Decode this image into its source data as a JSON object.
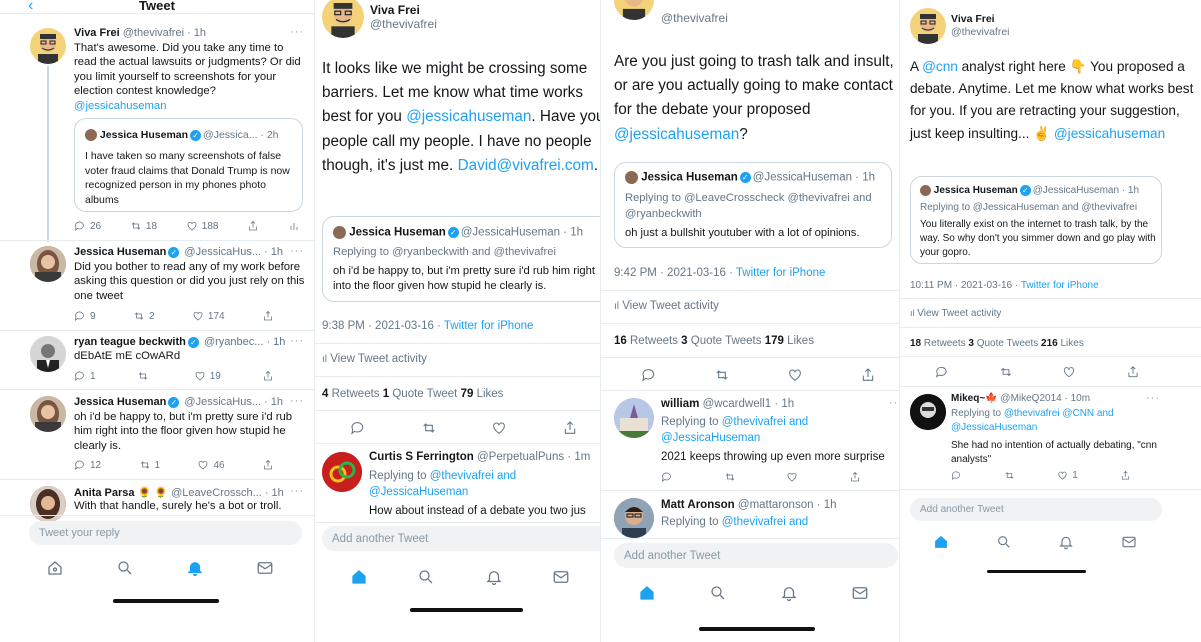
{
  "panel1": {
    "header_title": "Tweet",
    "tweet1": {
      "name": "Viva Frei",
      "handle": "@thevivafrei · 1h",
      "text": "That's awesome. Did you take any time to read the actual lawsuits or judgments? Or did you limit yourself to screenshots for your election contest knowledge?",
      "mention": "@jessicahuseman",
      "quote": {
        "name": "Jessica Huseman",
        "handle": "@Jessica...",
        "time": "· 2h",
        "text": "I have taken so many screenshots of false voter fraud claims that Donald Trump is now recognized person in my phones photo albums"
      },
      "replies": "26",
      "retweets": "18",
      "likes": "188"
    },
    "tweet2": {
      "name": "Jessica Huseman",
      "handle": "@JessicaHus... · 1h",
      "text": "Did you bother to read any of my work before asking this question or did you just rely on this one tweet",
      "replies": "9",
      "retweets": "2",
      "likes": "174"
    },
    "tweet3": {
      "name": "ryan teague beckwith",
      "handle": "@ryanbec... · 1h",
      "text": "dEbAtE mE cOwARd",
      "replies": "1",
      "retweets": "",
      "likes": "19"
    },
    "tweet4": {
      "name": "Jessica Huseman",
      "handle": "@JessicaHus... · 1h",
      "text": "oh i'd be happy to, but i'm pretty sure i'd rub him right into the floor given how stupid he clearly is.",
      "replies": "12",
      "retweets": "1",
      "likes": "46"
    },
    "tweet5": {
      "name": "Anita Parsa 🌻 🌻",
      "handle": "@LeaveCrossch... · 1h",
      "text": "With that handle, surely he's a bot or troll."
    },
    "reply_placeholder": "Tweet your reply"
  },
  "panel2": {
    "name": "Viva Frei",
    "handle": "@thevivafrei",
    "text_a": "It looks like we might be crossing some barriers. Let me know what time works best for you ",
    "mention": "@jessicahuseman",
    "text_b": ". Have your people call my people. I have no people though, it's just me. ",
    "email": "David@vivafrei.com",
    "text_c": ".",
    "quote": {
      "name": "Jessica Huseman",
      "handle": "@JessicaHuseman · 1h",
      "replying": "Replying to @ryanbeckwith and @thevivafrei",
      "text": "oh i'd be happy to, but i'm pretty sure i'd rub him right into the floor given how stupid he clearly is."
    },
    "timestamp": "9:38 PM · 2021-03-16 · ",
    "source": "Twitter for iPhone",
    "activity": "View Tweet activity",
    "retweets": "4",
    "retweets_label": "Retweets",
    "quotes": "1",
    "quotes_label": "Quote Tweet",
    "likes": "79",
    "likes_label": "Likes",
    "reply": {
      "name": "Curtis S Ferrington",
      "handle": "@PerpetualPuns · 1m",
      "replying_prefix": "Replying to ",
      "replying_a": "@thevivafrei and",
      "replying_b": "@JessicaHuseman",
      "text": "How about instead of a debate you two jus"
    },
    "add_placeholder": "Add another Tweet"
  },
  "panel3": {
    "handle": "@thevivafrei",
    "text": "Are you just going to trash talk and insult, or are you actually going to make contact for the debate your proposed ",
    "mention": "@jessicahuseman",
    "text_end": "?",
    "quote": {
      "name": "Jessica Huseman",
      "handle": "@JessicaHuseman · 1h",
      "replying": "Replying to @LeaveCrosscheck @thevivafrei and @ryanbeckwith",
      "text": "oh just a bullshit youtuber with a lot of opinions."
    },
    "timestamp": "9:42 PM · 2021-03-16 · ",
    "source": "Twitter for iPhone",
    "activity": "View Tweet activity",
    "retweets": "16",
    "retweets_label": "Retweets",
    "quotes": "3",
    "quotes_label": "Quote Tweets",
    "likes": "179",
    "likes_label": "Likes",
    "reply1": {
      "name": "william",
      "handle": "@wcardwell1 · 1h",
      "replying_prefix": "Replying to ",
      "replying_a": "@thevivafrei and",
      "replying_b": "@JessicaHuseman",
      "text": "2021 keeps throwing up even more surprise"
    },
    "reply2": {
      "name": "Matt Aronson",
      "handle": "@mattaronson · 1h",
      "replying_prefix": "Replying to ",
      "replying_a": "@thevivafrei and"
    },
    "add_placeholder": "Add another Tweet"
  },
  "panel4": {
    "name": "Viva Frei",
    "handle": "@thevivafrei",
    "text_a": "A ",
    "mention_cnn": "@cnn",
    "text_b": " analyst right here 👇 You proposed a debate. Anytime. Let me know what works best for you. If you are retracting your suggestion, just keep insulting... ✌️ ",
    "mention": "@jessicahuseman",
    "quote": {
      "name": "Jessica Huseman",
      "handle": "@JessicaHuseman · 1h",
      "replying": "Replying to @JessicaHuseman and @thevivafrei",
      "text": "You literally exist on the internet to trash talk, by the way. So why don't you simmer down and go play with your gopro."
    },
    "timestamp": "10:11 PM · 2021-03-16 · ",
    "source": "Twitter for iPhone",
    "activity": "View Tweet activity",
    "retweets": "18",
    "retweets_label": "Retweets",
    "quotes": "3",
    "quotes_label": "Quote Tweets",
    "likes": "216",
    "likes_label": "Likes",
    "reply": {
      "name": "Mikeq~🍁",
      "handle": "@MikeQ2014 · 10m",
      "replying_prefix": "Replying to ",
      "replying_a": "@thevivafrei @CNN and",
      "replying_b": "@JessicaHuseman",
      "text": "She had no intention of actually debating, \"cnn analysts\"",
      "likes": "1"
    },
    "add_placeholder": "Add another Tweet"
  },
  "colors": {
    "accent": "#1da1f2",
    "muted": "#657786",
    "border": "#e6ecf0"
  }
}
